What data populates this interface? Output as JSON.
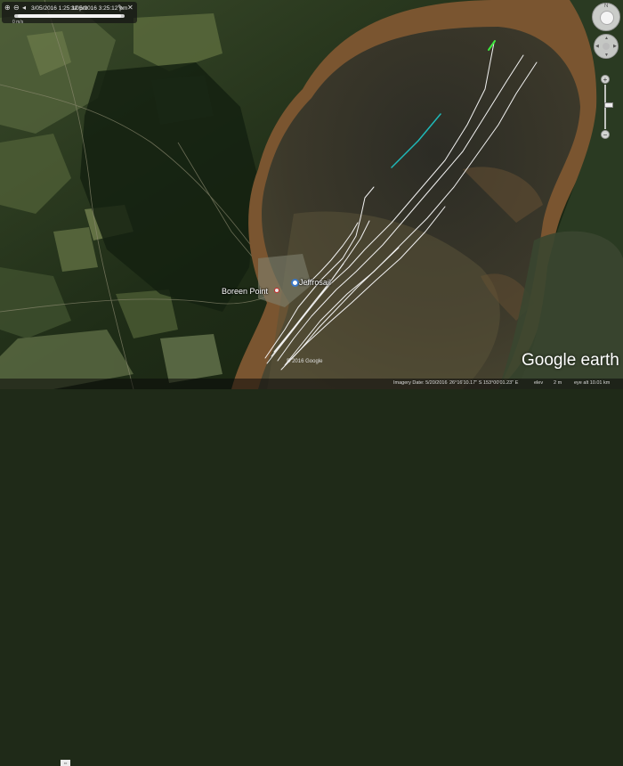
{
  "time_slider": {
    "start_date": "3/05/2016 1:25:12 pm",
    "end_date": "3/05/2016 3:25:12 pm",
    "note": "0 m/s"
  },
  "nav": {
    "north_label": "N"
  },
  "places": {
    "town_label": "Boreen Point",
    "boat_label": "Jeffrosail"
  },
  "watermark": "© 2016 Google",
  "logo": "Google earth",
  "status": {
    "imagery_date": "Imagery Date: 5/20/2016",
    "coords": "26°16'10.17\" S  153°00'01.23\" E",
    "elev_label": "elev",
    "elev_value": "2 m",
    "eye_alt": "eye alt  10.01 km"
  },
  "colors": {
    "track": "#f2f2f2",
    "track_highlight": "#1fb8b8",
    "track_end": "#3ee83e",
    "water": "#3b382a",
    "sand": "#8a5a2e",
    "forest": "#1c2d16"
  }
}
